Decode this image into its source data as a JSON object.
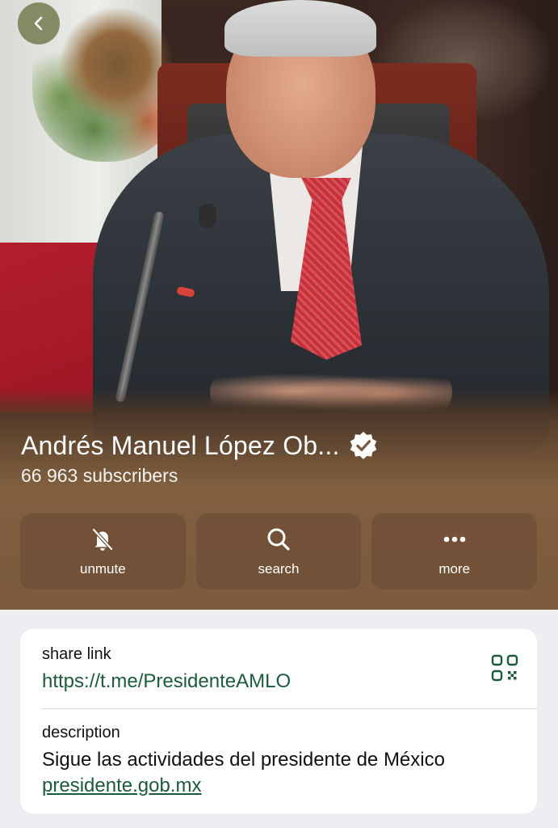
{
  "header": {
    "back_icon": "chevron-left-icon"
  },
  "channel": {
    "title": "Andrés Manuel López Ob...",
    "verified_icon": "verified-badge-icon",
    "subscribers": "66 963 subscribers"
  },
  "actions": [
    {
      "label": "unmute",
      "icon": "bell-muted-icon"
    },
    {
      "label": "search",
      "icon": "search-icon"
    },
    {
      "label": "more",
      "icon": "more-dots-icon"
    }
  ],
  "info": {
    "share_link_label": "share link",
    "share_link_url": "https://t.me/PresidenteAMLO",
    "qr_icon": "qr-code-icon",
    "description_label": "description",
    "description_text": "Sigue las actividades del presidente de México",
    "description_link": "presidente.gob.mx"
  },
  "colors": {
    "link_green": "#1c5b3a",
    "page_background": "#eeedf2",
    "card_background": "#ffffff"
  }
}
